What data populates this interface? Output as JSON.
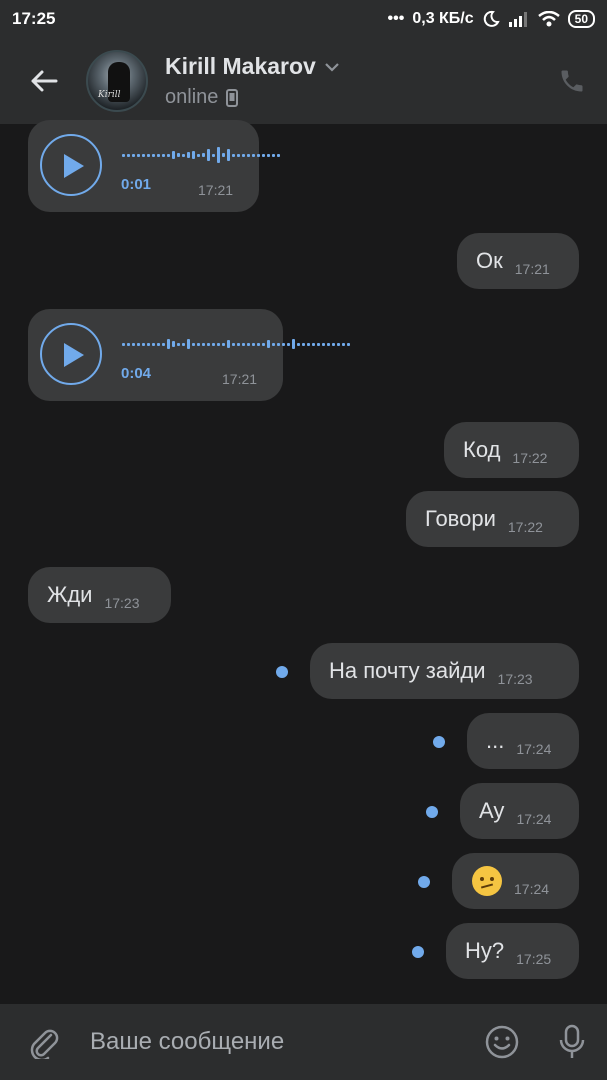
{
  "status_bar": {
    "time": "17:25",
    "dots": "•••",
    "speed": "0,3 КБ/с",
    "battery": "50"
  },
  "header": {
    "name": "Kirill Makarov",
    "status": "online",
    "avatar_caption": "Kirill"
  },
  "voice_messages": [
    {
      "duration": "0:01",
      "time": "17:21"
    },
    {
      "duration": "0:04",
      "time": "17:21"
    }
  ],
  "messages": [
    {
      "text": "Ок",
      "time": "17:21",
      "side": "out"
    },
    {
      "text": "Код",
      "time": "17:22",
      "side": "out"
    },
    {
      "text": "Говори",
      "time": "17:22",
      "side": "out"
    },
    {
      "text": "Жди",
      "time": "17:23",
      "side": "in"
    },
    {
      "text": "На почту зайди",
      "time": "17:23",
      "side": "out",
      "unread": true
    },
    {
      "text": "...",
      "time": "17:24",
      "side": "out",
      "unread": true
    },
    {
      "text": "Ау",
      "time": "17:24",
      "side": "out",
      "unread": true
    },
    {
      "emoji": "confused-face",
      "time": "17:24",
      "side": "out",
      "unread": true
    },
    {
      "text": "Ну?",
      "time": "17:25",
      "side": "out",
      "unread": true
    }
  ],
  "composer": {
    "placeholder": "Ваше сообщение"
  },
  "colors": {
    "accent": "#71aaeb",
    "bubble": "#3a3b3c",
    "background": "#19191a",
    "bar": "#2c2d2e"
  }
}
